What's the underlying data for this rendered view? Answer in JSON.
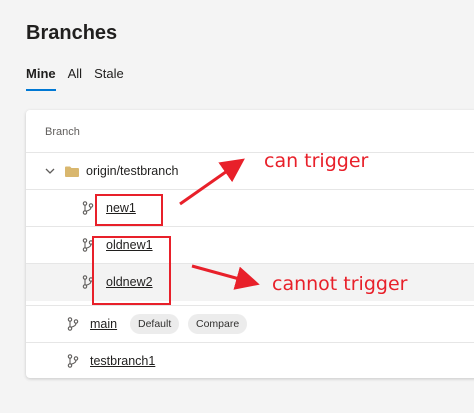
{
  "page": {
    "title": "Branches"
  },
  "tabs": [
    {
      "label": "Mine",
      "active": true
    },
    {
      "label": "All",
      "active": false
    },
    {
      "label": "Stale",
      "active": false
    }
  ],
  "table": {
    "column_header": "Branch",
    "folder": {
      "label": "origin/testbranch",
      "icon": "folder-icon",
      "expanded": true
    },
    "branches": [
      {
        "name": "new1",
        "icon": "branch-icon"
      },
      {
        "name": "oldnew1",
        "icon": "branch-icon"
      },
      {
        "name": "oldnew2",
        "icon": "branch-icon"
      },
      {
        "name": "main",
        "icon": "branch-icon",
        "badges": [
          "Default",
          "Compare"
        ]
      },
      {
        "name": "testbranch1",
        "icon": "branch-icon"
      }
    ]
  },
  "annotations": {
    "can_trigger": "can trigger",
    "cannot_trigger": "cannot trigger",
    "color": "#e8202a"
  },
  "colors": {
    "accent": "#0078d4",
    "folder": "#d9b76e"
  }
}
